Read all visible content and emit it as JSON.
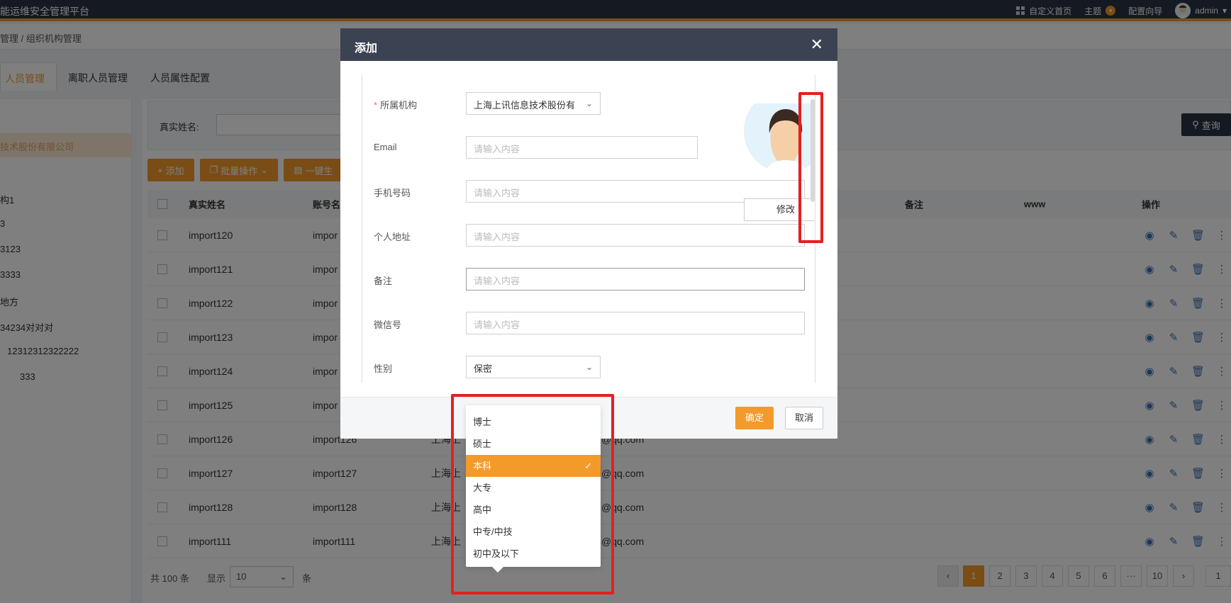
{
  "topbar": {
    "app_title": "能运维安全管理平台",
    "custom_home": "自定义首页",
    "theme": "主题",
    "config_guide": "配置向导",
    "user": "admin"
  },
  "breadcrumb": "管理 / 组织机构管理",
  "tabs": [
    {
      "label": "人员管理"
    },
    {
      "label": "离职人员管理"
    },
    {
      "label": "人员属性配置"
    }
  ],
  "tree": {
    "selected": "技术股份有限公司",
    "nodes": [
      "构1",
      "3",
      "3123",
      "3333",
      "地方",
      "34234对对对",
      "12312312322222",
      "333"
    ]
  },
  "search": {
    "label": "真实姓名:",
    "query_button": "查询"
  },
  "toolbar": {
    "add": "添加",
    "batch": "批量操作",
    "one_key": "一键生"
  },
  "table": {
    "headers": {
      "name": "真实姓名",
      "account": "账号名",
      "remark": "备注",
      "www": "www",
      "ops": "操作"
    },
    "rows": [
      {
        "name": "import120",
        "account": "impor",
        "org": "",
        "email": ""
      },
      {
        "name": "import121",
        "account": "impor",
        "org": "",
        "email": ""
      },
      {
        "name": "import122",
        "account": "impor",
        "org": "",
        "email": ""
      },
      {
        "name": "import123",
        "account": "impor",
        "org": "",
        "email": ""
      },
      {
        "name": "import124",
        "account": "impor",
        "org": "",
        "email": ""
      },
      {
        "name": "import125",
        "account": "impor",
        "org": "",
        "email": ""
      },
      {
        "name": "import126",
        "account": "import126",
        "org": "上海上",
        "email": "@qq.com"
      },
      {
        "name": "import127",
        "account": "import127",
        "org": "上海上",
        "email": "@qq.com"
      },
      {
        "name": "import128",
        "account": "import128",
        "org": "上海上",
        "email": "@qq.com"
      },
      {
        "name": "import111",
        "account": "import111",
        "org": "上海上",
        "email": "@qq.com"
      }
    ]
  },
  "pager": {
    "info": "共 100 条",
    "show": "显示",
    "size": "10",
    "unit": "条",
    "pages": [
      "1",
      "2",
      "3",
      "4",
      "5",
      "6",
      "···",
      "10"
    ],
    "current": "1",
    "jump": "1"
  },
  "modal": {
    "title": "添加",
    "fields": {
      "org": {
        "label": "所属机构",
        "value": "上海上讯信息技术股份有"
      },
      "email": {
        "label": "Email",
        "placeholder": "请输入内容"
      },
      "phone": {
        "label": "手机号码",
        "placeholder": "请输入内容"
      },
      "address": {
        "label": "个人地址",
        "placeholder": "请输入内容"
      },
      "remark": {
        "label": "备注",
        "placeholder": "请输入内容"
      },
      "wechat": {
        "label": "微信号",
        "placeholder": "请输入内容"
      },
      "gender": {
        "label": "性别",
        "value": "保密"
      }
    },
    "modify_button": "修改",
    "ok_button": "确定",
    "cancel_button": "取消"
  },
  "education_dropdown": {
    "options": [
      "博士",
      "硕士",
      "本科",
      "大专",
      "高中",
      "中专/中技",
      "初中及以下"
    ],
    "selected": "本科"
  },
  "colors": {
    "accent": "#f39a2b",
    "header": "#2b3242",
    "highlight": "#e42020"
  }
}
